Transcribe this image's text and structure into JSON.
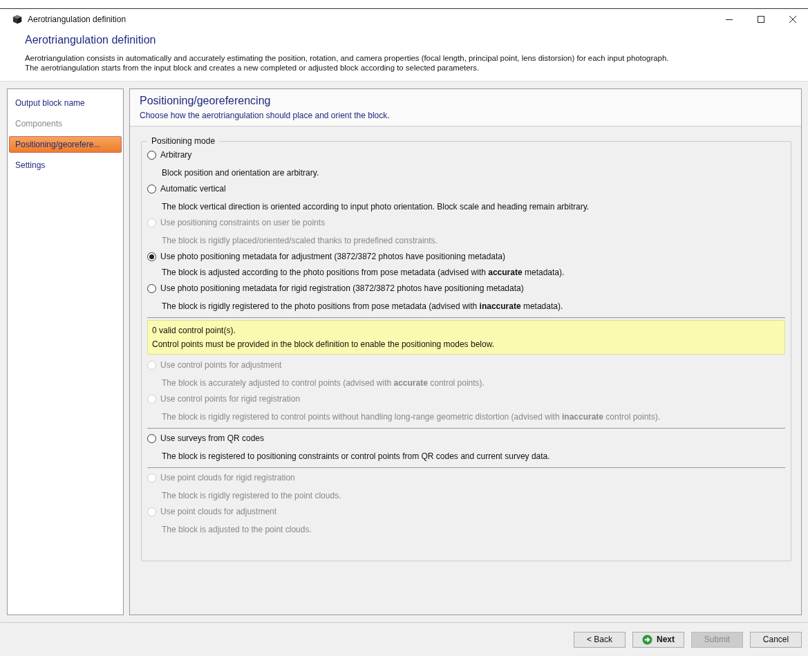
{
  "window": {
    "title": "Aerotriangulation definition"
  },
  "header": {
    "title": "Aerotriangulation definition",
    "description": [
      "Aerotriangulation consists in automatically and accurately estimating the position, rotation, and camera properties (focal length, principal point, lens distorsion) for each input photograph.",
      "The aerotriangulation starts from the input block and creates a new completed or adjusted block according to selected parameters."
    ]
  },
  "sidebar": {
    "items": [
      {
        "label": "Output block name",
        "selected": false,
        "disabled": false
      },
      {
        "label": "Components",
        "selected": false,
        "disabled": true
      },
      {
        "label": "Positioning/georefere...",
        "selected": true,
        "disabled": false
      },
      {
        "label": "Settings",
        "selected": false,
        "disabled": false
      }
    ]
  },
  "page": {
    "title": "Positioning/georeferencing",
    "subtitle": "Choose how the aerotriangulation should place and orient the block.",
    "group_title": "Positioning mode",
    "groups": [
      {
        "options": [
          {
            "label": "Arbitrary",
            "description": "Block position and orientation are arbitrary.",
            "selected": false,
            "disabled": false
          },
          {
            "label": "Automatic vertical",
            "description": "The block vertical direction is oriented according to input photo orientation. Block scale and heading remain arbitrary.",
            "selected": false,
            "disabled": false
          },
          {
            "label": "Use positioning constraints on user tie points",
            "description": "The block is rigidly placed/oriented/scaled thanks to predefined constraints.",
            "selected": false,
            "disabled": true
          },
          {
            "label": "Use photo positioning metadata for adjustment (3872/3872 photos have positioning metadata)",
            "description": "The block is adjusted according to the photo positions from pose metadata (advised with **accurate** metadata).",
            "selected": true,
            "disabled": false
          },
          {
            "label": "Use photo positioning metadata for rigid registration (3872/3872 photos have positioning metadata)",
            "description": "The block is rigidly registered to the photo positions from pose metadata (advised with **inaccurate** metadata).",
            "selected": false,
            "disabled": false
          }
        ]
      },
      {
        "notice": [
          "0 valid control point(s).",
          "Control points must be provided in the block definition to enable the positioning modes below."
        ],
        "options": [
          {
            "label": "Use control points for adjustment",
            "description": "The block is accurately adjusted to control points (advised with **accurate** control points).",
            "selected": false,
            "disabled": true
          },
          {
            "label": "Use control points for rigid registration",
            "description": "The block is rigidly registered to control points without handling long-range geometric distortion (advised with **inaccurate** control points).",
            "selected": false,
            "disabled": true
          }
        ]
      },
      {
        "options": [
          {
            "label": "Use surveys from QR codes",
            "description": "The block is registered to positioning constraints or control points from QR codes and current survey data.",
            "selected": false,
            "disabled": false
          }
        ]
      },
      {
        "options": [
          {
            "label": "Use point clouds for rigid registration",
            "description": "The block is rigidly registered to the point clouds.",
            "selected": false,
            "disabled": true
          },
          {
            "label": "Use point clouds for adjustment",
            "description": "The block is adjusted to the point clouds.",
            "selected": false,
            "disabled": true
          }
        ]
      }
    ]
  },
  "buttons": [
    {
      "label": "< Back",
      "kind": "plain",
      "disabled": false
    },
    {
      "label": "Next",
      "kind": "next",
      "disabled": false
    },
    {
      "label": "Submit",
      "kind": "plain",
      "disabled": true
    },
    {
      "label": "Cancel",
      "kind": "plain",
      "disabled": false
    }
  ]
}
